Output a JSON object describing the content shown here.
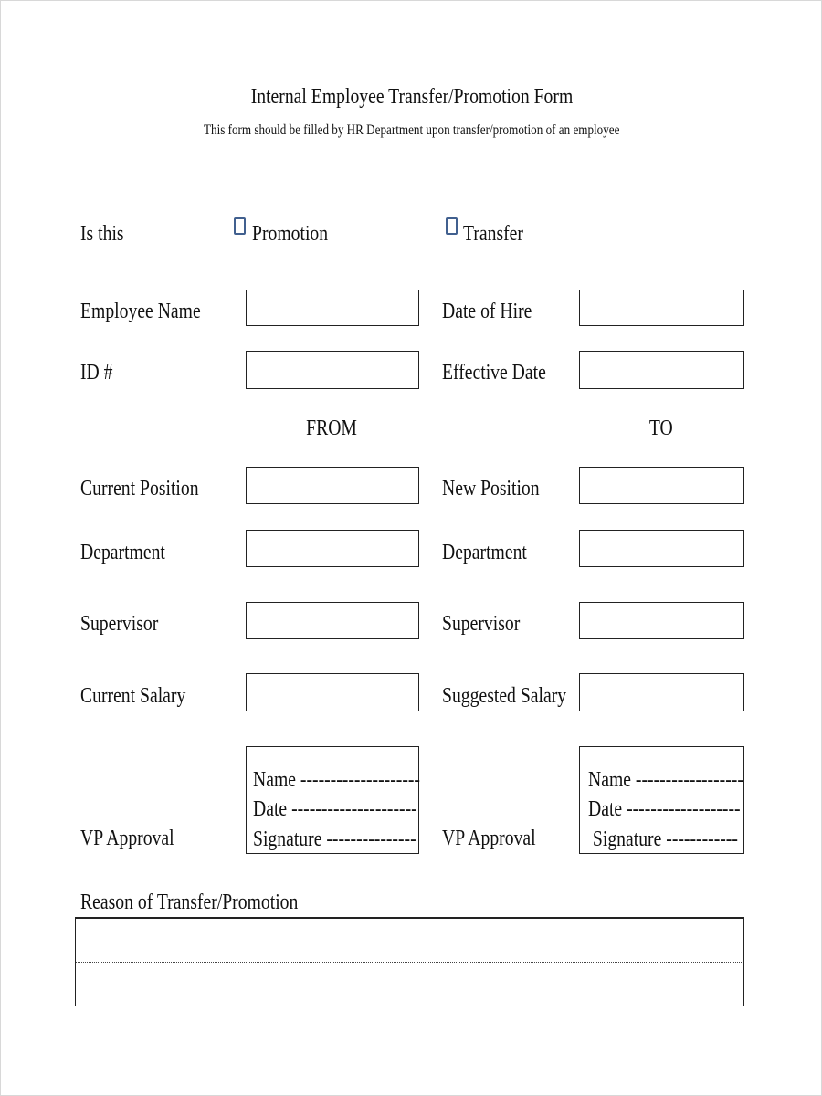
{
  "header": {
    "title": "Internal Employee Transfer/Promotion Form",
    "subtitle": "This form should be filled by HR Department  upon transfer/promotion of an employee"
  },
  "type_selection": {
    "label": "Is this",
    "options": [
      {
        "label": "Promotion",
        "checked": false
      },
      {
        "label": "Transfer",
        "checked": false
      }
    ],
    "checkbox_color": "#41608f"
  },
  "employee_info": {
    "employee_name_label": "Employee Name",
    "employee_name_value": "",
    "date_of_hire_label": "Date of Hire",
    "date_of_hire_value": "",
    "id_label": "ID #",
    "id_value": "",
    "effective_date_label": "Effective Date",
    "effective_date_value": ""
  },
  "columns": {
    "from_heading": "FROM",
    "to_heading": "TO"
  },
  "from": {
    "position_label": "Current Position",
    "position_value": "",
    "department_label": "Department",
    "department_value": "",
    "supervisor_label": " Supervisor",
    "supervisor_value": "",
    "salary_label": "Current Salary",
    "salary_value": "",
    "vp_approval_label": "VP Approval",
    "vp_approval_lines": {
      "name": "Name --------------------",
      "date": "Date ---------------------",
      "signature": "Signature ---------------"
    }
  },
  "to": {
    "position_label": "New Position",
    "position_value": "",
    "department_label": "Department",
    "department_value": "",
    "supervisor_label": "Supervisor",
    "supervisor_value": "",
    "salary_label": "Suggested Salary",
    "salary_value": "",
    "vp_approval_label": "VP Approval",
    "vp_approval_lines": {
      "name": "Name ------------------",
      "date": "Date -------------------",
      "signature": " Signature ------------"
    }
  },
  "reason": {
    "label": "Reason of Transfer/Promotion",
    "value": ""
  }
}
